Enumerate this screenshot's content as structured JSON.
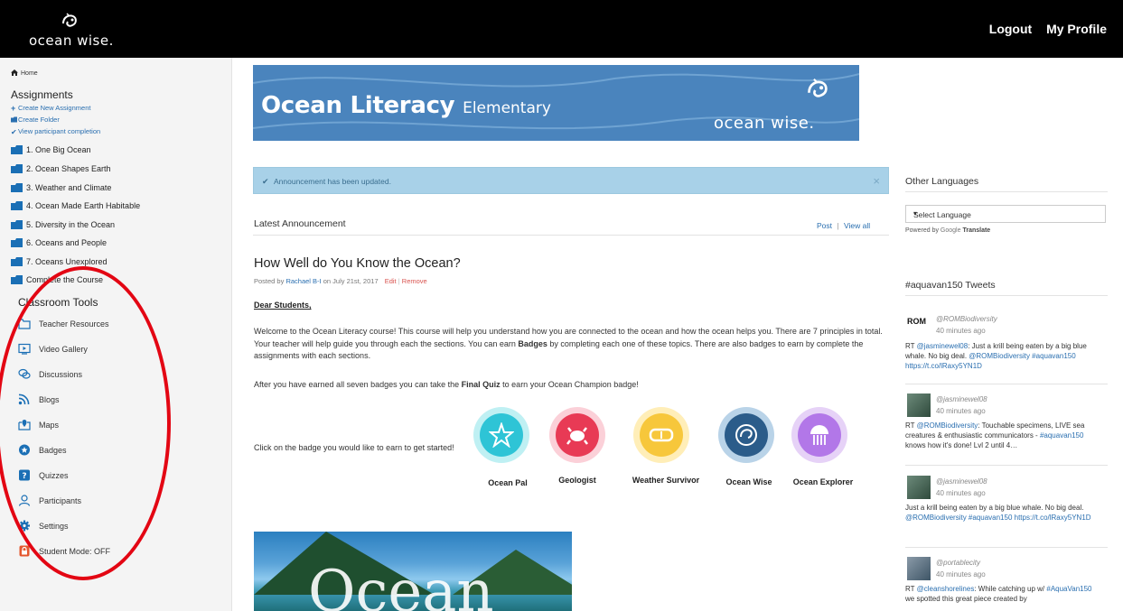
{
  "header": {
    "logo_text": "ocean wise.",
    "logout": "Logout",
    "profile": "My Profile"
  },
  "sidebar": {
    "home": "Home",
    "assignments_heading": "Assignments",
    "links": [
      "Create New Assignment",
      "Create Folder",
      "View participant completion"
    ],
    "folders": [
      "1. One Big Ocean",
      "2. Ocean Shapes Earth",
      "3. Weather and Climate",
      "4. Ocean Made Earth Habitable",
      "5. Diversity in the Ocean",
      "6. Oceans and People",
      "7. Oceans Unexplored",
      "Complete the Course"
    ],
    "tools_heading": "Classroom Tools",
    "tools": [
      "Teacher Resources",
      "Video Gallery",
      "Discussions",
      "Blogs",
      "Maps",
      "Badges",
      "Quizzes",
      "Participants",
      "Settings",
      "Student Mode: OFF"
    ]
  },
  "banner": {
    "title": "Ocean Literacy",
    "subtitle": "Elementary",
    "logo": "ocean wise."
  },
  "alert": {
    "text": "Announcement has been updated.",
    "close": "×"
  },
  "announcement": {
    "heading": "Latest Announcement",
    "post": "Post",
    "separator": "|",
    "view_all": "View all",
    "title": "How Well do You Know the Ocean?",
    "meta_prefix": "Posted by",
    "author": "Rachael B-I",
    "meta_date": "on July 21st, 2017",
    "edit": "Edit",
    "remove": "Remove",
    "greeting": "Dear Students,",
    "p1_a": "Welcome to the Ocean Literacy course! This course will help you understand how you are connected to the ocean and how the ocean helps you. There are 7 principles in total. Your teacher will help guide you through each the sections. You can earn ",
    "p1_b": "Badges",
    "p1_c": " by completing each one of these topics. There are also badges to earn by complete the assignments with each sections.",
    "p2_a": "After you have earned all seven badges you can take the ",
    "p2_b": "Final Quiz",
    "p2_c": " to earn your Ocean Champion badge!",
    "click_text": "Click on the badge you would like to earn to get started!",
    "badges": [
      "Ocean Pal",
      "Geologist",
      "Weather Survivor",
      "Ocean Wise",
      "Ocean Explorer"
    ],
    "image_text": "Ocean"
  },
  "right": {
    "languages_heading": "Other Languages",
    "select_value": "Select Language",
    "powered_by": "Powered by",
    "google": "Google",
    "translate": "Translate",
    "tweets_heading": "#aquavan150 Tweets",
    "tweets": [
      {
        "avatar": "ROM",
        "handle": "@ROMBiodiversity",
        "time": "40 minutes ago",
        "t1": "RT ",
        "l1": "@jasminewel08",
        "t2": ": Just a krill being eaten by a big blue whale. No big deal. ",
        "l2": "@ROMBiodiversity #aquavan150 https://t.co/lRaxy5YN1D"
      },
      {
        "handle": "@jasminewel08",
        "time": "40 minutes ago",
        "t1": "RT ",
        "l1": "@ROMBiodiversity",
        "t2": ": Touchable specimens, LIVE sea creatures & enthusiastic communicators - ",
        "l2": "#aquavan150",
        "t3": " knows how it's done! Lvl 2 until 4…"
      },
      {
        "handle": "@jasminewel08",
        "time": "40 minutes ago",
        "t1": "Just a krill being eaten by a big blue whale. No big deal. ",
        "l1": "@ROMBiodiversity #aquavan150 https://t.co/lRaxy5YN1D"
      },
      {
        "handle": "@portablecity",
        "time": "40 minutes ago",
        "t1": "RT ",
        "l1": "@cleanshorelines",
        "t2": ": While catching up w/ ",
        "l2": "#AquaVan150",
        "t3": " we spotted this great piece created by"
      }
    ]
  }
}
